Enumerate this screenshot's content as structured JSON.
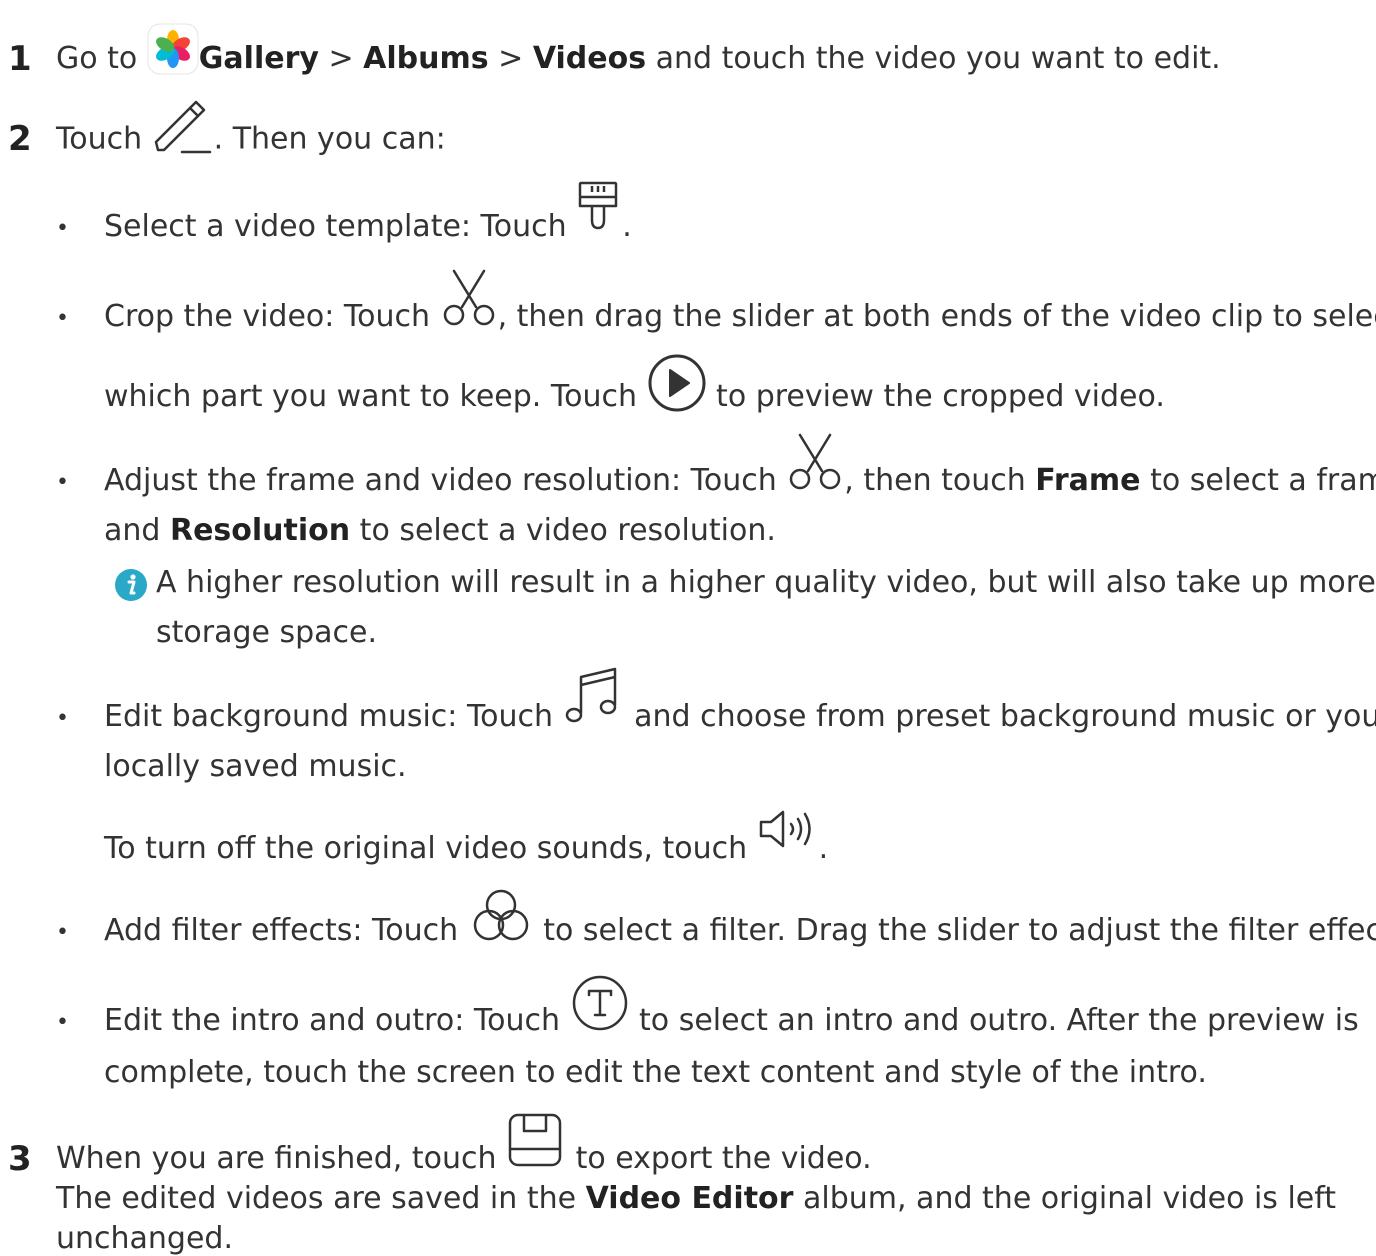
{
  "steps": [
    {
      "number": "1",
      "t1": "Go to ",
      "b1": "Gallery",
      "t2": " > ",
      "b2": "Albums",
      "t3": " > ",
      "b3": "Videos",
      "t4": " and touch the video you want to edit."
    },
    {
      "number": "2",
      "t1": "Touch ",
      "t2": ". Then you can:"
    },
    {
      "number": "3",
      "t1": "When you are finished, touch ",
      "t2": " to export the video.",
      "p2a": "The edited videos are saved in the ",
      "p2b": "Video Editor",
      "p2c": " album, and the original video is left",
      "p2d": "unchanged."
    }
  ],
  "bullets": {
    "template": {
      "t1": "Select a video template: Touch ",
      "t2": "."
    },
    "crop": {
      "t1": "Crop the video: Touch ",
      "t2": ", then drag the slider at both ends of the video clip to select",
      "t3": "which part you want to keep. Touch ",
      "t4": " to preview the cropped video."
    },
    "frame": {
      "t1": "Adjust the frame and video resolution: Touch ",
      "t2": ", then touch ",
      "b1": "Frame",
      "t3": " to select a frame,",
      "t4": "and ",
      "b2": "Resolution",
      "t5": " to select a video resolution."
    },
    "note": {
      "l1": "A higher resolution will result in a higher quality video, but will also take up more",
      "l2": "storage space."
    },
    "music": {
      "t1": "Edit background music: Touch ",
      "t2": " and choose from preset background music or your",
      "t3": "locally saved music.",
      "t4": "To turn off the original video sounds, touch ",
      "t5": "."
    },
    "filter": {
      "t1": "Add filter effects: Touch ",
      "t2": " to select a filter. Drag the slider to adjust the filter effect."
    },
    "intro": {
      "t1": "Edit the intro and outro: Touch ",
      "t2": " to select an intro and outro. After the preview is",
      "t3": "complete, touch the screen to edit the text content and style of the intro."
    }
  },
  "bullet_char": "•",
  "colors": {
    "text": "#333333",
    "info_icon": "#2aa8c8"
  },
  "icons": [
    "gallery-icon",
    "edit-pencil-icon",
    "template-brush-icon",
    "scissors-icon",
    "play-icon",
    "music-note-icon",
    "speaker-icon",
    "filter-icon",
    "text-t-icon",
    "save-icon",
    "info-icon"
  ]
}
